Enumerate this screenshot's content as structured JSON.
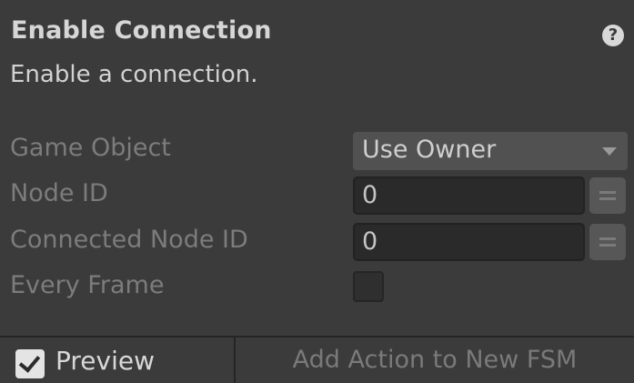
{
  "action": {
    "title": "Enable Connection",
    "help_icon": "help-icon",
    "help_glyph": "?",
    "description": "Enable a connection."
  },
  "fields": {
    "game_object": {
      "label": "Game Object",
      "value": "Use Owner"
    },
    "node_id": {
      "label": "Node ID",
      "value": "0"
    },
    "connected_node_id": {
      "label": "Connected Node ID",
      "value": "0"
    },
    "every_frame": {
      "label": "Every Frame",
      "checked": false
    }
  },
  "footer": {
    "preview_label": "Preview",
    "preview_checked": true,
    "add_action_label": "Add Action to New FSM"
  },
  "colors": {
    "background": "#3b3b3b",
    "field_background": "#2a2a2a",
    "label_disabled": "#7c7c7c"
  }
}
